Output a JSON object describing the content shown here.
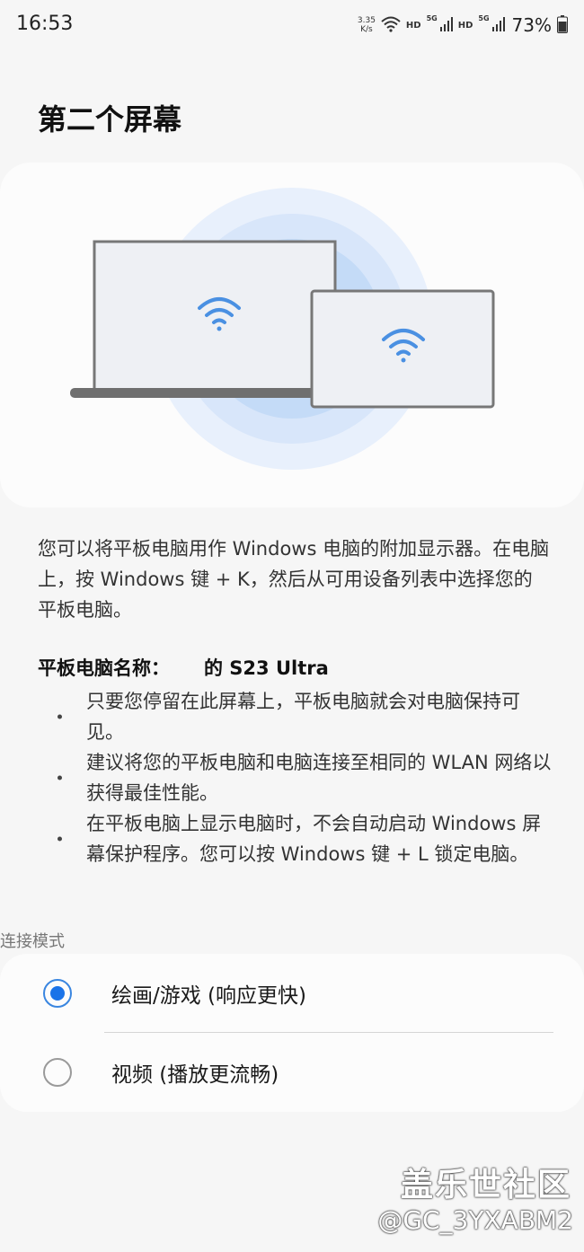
{
  "status_bar": {
    "time": "16:53",
    "net_speed_value": "3.35",
    "net_speed_unit": "K/s",
    "sig1_label": "5G",
    "hd1": "HD",
    "sig2_label": "5G",
    "hd2": "HD",
    "battery": "73%",
    "icons": [
      "wifi-icon",
      "signal-icon",
      "battery-icon"
    ]
  },
  "page": {
    "title": "第二个屏幕"
  },
  "description": "您可以将平板电脑用作 Windows 电脑的附加显示器。在电脑上，按 Windows 键 + K，然后从可用设备列表中选择您的平板电脑。",
  "tablet_name": {
    "label": "平板电脑名称：",
    "value": "的 S23 Ultra"
  },
  "tips": [
    "只要您停留在此屏幕上，平板电脑就会对电脑保持可见。",
    "建议将您的平板电脑和电脑连接至相同的 WLAN 网络以获得最佳性能。",
    "在平板电脑上显示电脑时，不会自动启动 Windows 屏幕保护程序。您可以按 Windows 键 + L 锁定电脑。"
  ],
  "connection_mode": {
    "section_label": "连接模式",
    "options": [
      {
        "label": "绘画/游戏 (响应更快)",
        "selected": true
      },
      {
        "label": "视频 (播放更流畅)",
        "selected": false
      }
    ]
  },
  "watermark": {
    "logo": "盖乐世社区",
    "user": "@GC_3YXABM2"
  },
  "colors": {
    "accent": "#1a73e8",
    "illustration_glow": "#c9ddfa",
    "wifi_blue": "#4a90e2"
  }
}
